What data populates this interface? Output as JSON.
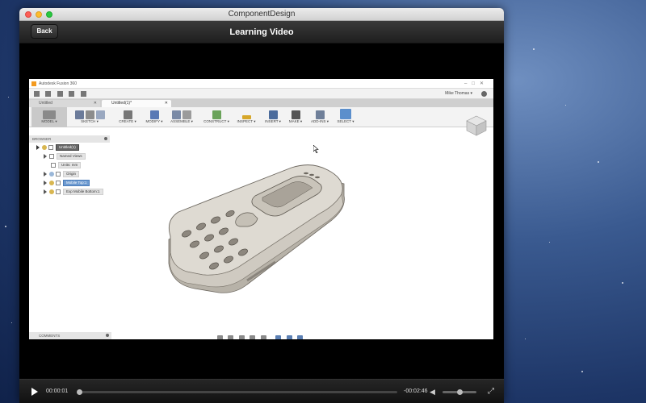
{
  "window": {
    "title": "ComponentDesign"
  },
  "navbar": {
    "back_label": "Back",
    "title": "Learning Video"
  },
  "fusion": {
    "app_title": "Autodesk Fusion 360",
    "user": "Mike Thomas ▾",
    "tabs": [
      {
        "label": "Untitled"
      },
      {
        "label": "Untitled(1)*"
      }
    ],
    "workspace": "MODEL ▾",
    "ribbon": [
      {
        "label": "SKETCH ▾"
      },
      {
        "label": "CREATE ▾"
      },
      {
        "label": "MODIFY ▾"
      },
      {
        "label": "ASSEMBLE ▾"
      },
      {
        "label": "CONSTRUCT ▾"
      },
      {
        "label": "INSPECT ▾"
      },
      {
        "label": "INSERT ▾"
      },
      {
        "label": "MAKE ▾"
      },
      {
        "label": "ADD-INS ▾"
      },
      {
        "label": "SELECT ▾"
      }
    ],
    "browser": {
      "header": "BROWSER",
      "nodes": [
        {
          "label": "Untitled(1)"
        },
        {
          "label": "Named Views"
        },
        {
          "label": "Units: mm"
        },
        {
          "label": "Origin"
        },
        {
          "label": "Mobile Top:1"
        },
        {
          "label": "Exp Mobile Bottom:1"
        }
      ]
    },
    "comments": "COMMENTS",
    "colors": {
      "accent": "#5b8fcc",
      "selected": "#6e9bd1",
      "logo": "#f39a1e"
    }
  },
  "player": {
    "elapsed": "00:00:01",
    "remaining": "-00:02:46",
    "progress_fraction": 0.003,
    "volume_fraction": 0.5
  }
}
